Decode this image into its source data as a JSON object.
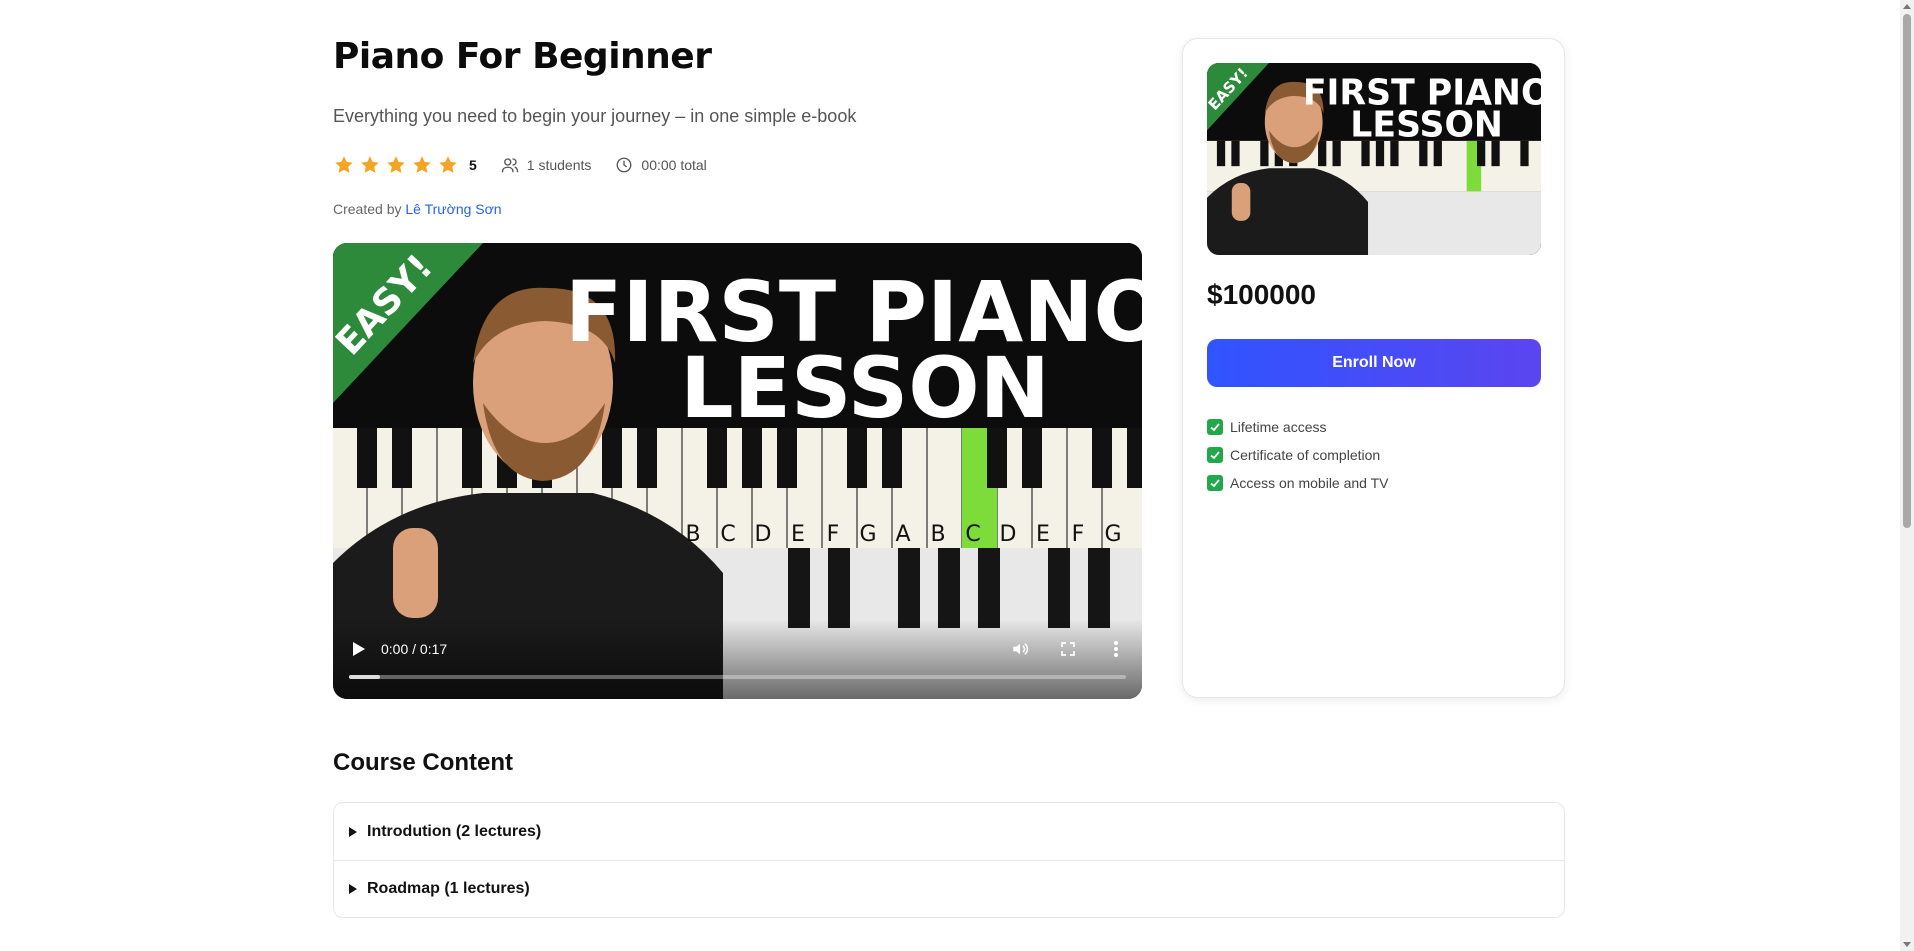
{
  "course": {
    "title": "Piano For Beginner",
    "subtitle": "Everything you need to begin your journey – in one simple e-book",
    "rating": "5",
    "rating_stars": 5,
    "students": "1 students",
    "duration": "00:00 total",
    "created_by_label": "Created by",
    "author": "Lê Trường Sơn"
  },
  "thumbnail": {
    "badge": "EASY!",
    "headline_1": "FIRST PIANO",
    "headline_2": "LESSON",
    "keys": [
      "B",
      "C",
      "D",
      "E",
      "F",
      "G",
      "A",
      "B",
      "C",
      "D",
      "E",
      "F",
      "G"
    ]
  },
  "video": {
    "time": "0:00 / 0:17",
    "progress_fraction": 0.04
  },
  "card": {
    "price": "$100000",
    "enroll_label": "Enroll Now",
    "features": [
      "Lifetime access",
      "Certificate of completion",
      "Access on mobile and TV"
    ]
  },
  "content": {
    "title": "Course Content",
    "sections": [
      "Introdution (2 lectures)",
      "Roadmap (1 lectures)"
    ]
  },
  "colors": {
    "accent": "#2f54ff",
    "accent_end": "#5b45ef",
    "star": "#f5a524",
    "check": "#22a84a",
    "link": "#2563eb",
    "highlight_key": "#7ddc3a"
  }
}
